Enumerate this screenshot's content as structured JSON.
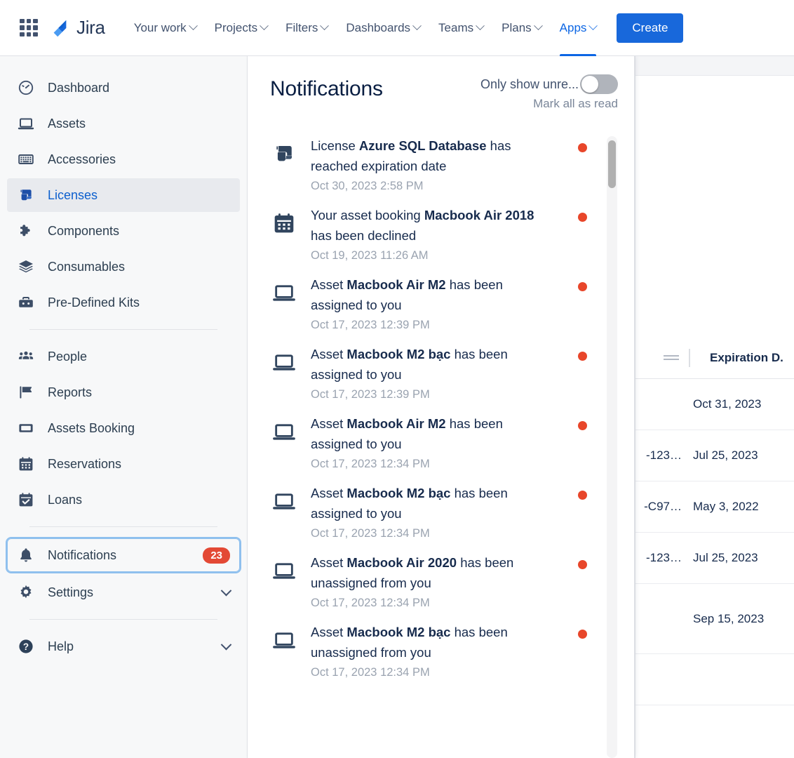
{
  "topnav": {
    "apps_grid_icon": "grid-icon",
    "brand": "Jira",
    "items": [
      {
        "label": "Your work",
        "active": false
      },
      {
        "label": "Projects",
        "active": false
      },
      {
        "label": "Filters",
        "active": false
      },
      {
        "label": "Dashboards",
        "active": false
      },
      {
        "label": "Teams",
        "active": false
      },
      {
        "label": "Plans",
        "active": false
      },
      {
        "label": "Apps",
        "active": true
      }
    ],
    "create_label": "Create",
    "create_color": "#1868db",
    "active_color": "#0c66e4"
  },
  "sidebar": {
    "groups": [
      {
        "items": [
          {
            "label": "Dashboard",
            "icon": "gauge-icon",
            "selected": false
          },
          {
            "label": "Assets",
            "icon": "laptop-icon",
            "selected": false
          },
          {
            "label": "Accessories",
            "icon": "keyboard-icon",
            "selected": false
          },
          {
            "label": "Licenses",
            "icon": "license-scroll-icon",
            "selected": true
          },
          {
            "label": "Components",
            "icon": "puzzle-icon",
            "selected": false
          },
          {
            "label": "Consumables",
            "icon": "layers-icon",
            "selected": false
          },
          {
            "label": "Pre-Defined Kits",
            "icon": "toolbox-icon",
            "selected": false
          }
        ]
      },
      {
        "items": [
          {
            "label": "People",
            "icon": "people-icon",
            "selected": false
          },
          {
            "label": "Reports",
            "icon": "flag-icon",
            "selected": false
          },
          {
            "label": "Assets Booking",
            "icon": "ticket-icon",
            "selected": false
          },
          {
            "label": "Reservations",
            "icon": "calendar-icon",
            "selected": false
          },
          {
            "label": "Loans",
            "icon": "calendar-check-icon",
            "selected": false
          }
        ]
      },
      {
        "items": [
          {
            "label": "Notifications",
            "icon": "bell-icon",
            "badge": "23",
            "focused": true
          },
          {
            "label": "Settings",
            "icon": "gear-icon",
            "chevron": true
          }
        ]
      },
      {
        "items": [
          {
            "label": "Help",
            "icon": "help-circle-icon",
            "chevron": true
          }
        ]
      }
    ],
    "badge_color": "#e34935",
    "focus_ring_color": "#8fc0ee",
    "selected_bg": "#e8eaee",
    "selected_text_color": "#0c5fce"
  },
  "panel": {
    "title": "Notifications",
    "only_unread_label": "Only show unre...",
    "only_unread_toggle": "off",
    "mark_all_label": "Mark all as read",
    "unread_dot_color": "#e8462a",
    "notifications": [
      {
        "icon": "license-scroll-icon",
        "prefix": "License ",
        "strong": "Azure SQL Database",
        "suffix": " has reached expiration date",
        "time": "Oct 30, 2023 2:58 PM",
        "unread": true
      },
      {
        "icon": "calendar-icon",
        "prefix": "Your asset booking ",
        "strong": "Macbook Air 2018",
        "suffix": " has been declined",
        "time": "Oct 19, 2023 11:26 AM",
        "unread": true
      },
      {
        "icon": "laptop-icon",
        "prefix": "Asset ",
        "strong": "Macbook Air M2",
        "suffix": " has been assigned to you",
        "time": "Oct 17, 2023 12:39 PM",
        "unread": true
      },
      {
        "icon": "laptop-icon",
        "prefix": "Asset ",
        "strong": "Macbook M2 bạc",
        "suffix": " has been assigned to you",
        "time": "Oct 17, 2023 12:39 PM",
        "unread": true
      },
      {
        "icon": "laptop-icon",
        "prefix": "Asset ",
        "strong": "Macbook Air M2",
        "suffix": " has been assigned to you",
        "time": "Oct 17, 2023 12:34 PM",
        "unread": true
      },
      {
        "icon": "laptop-icon",
        "prefix": "Asset ",
        "strong": "Macbook M2 bạc",
        "suffix": " has been assigned to you",
        "time": "Oct 17, 2023 12:34 PM",
        "unread": true
      },
      {
        "icon": "laptop-icon",
        "prefix": "Asset ",
        "strong": "Macbook Air 2020",
        "suffix": " has been unassigned from you",
        "time": "Oct 17, 2023 12:34 PM",
        "unread": true
      },
      {
        "icon": "laptop-icon",
        "prefix": "Asset ",
        "strong": "Macbook M2 bạc",
        "suffix": " has been unassigned from you",
        "time": "Oct 17, 2023 12:34 PM",
        "unread": true
      }
    ]
  },
  "background_table": {
    "column_header": "Expiration D.",
    "rows": [
      {
        "trunc": "",
        "date": "Oct 31, 2023"
      },
      {
        "trunc": "-123…",
        "date": "Jul 25, 2023"
      },
      {
        "trunc": "-C97…",
        "date": "May 3, 2022"
      },
      {
        "trunc": "-123…",
        "date": "Jul 25, 2023"
      },
      {
        "trunc": "",
        "date": "Sep 15, 2023"
      },
      {
        "trunc": "",
        "date": ""
      }
    ]
  }
}
